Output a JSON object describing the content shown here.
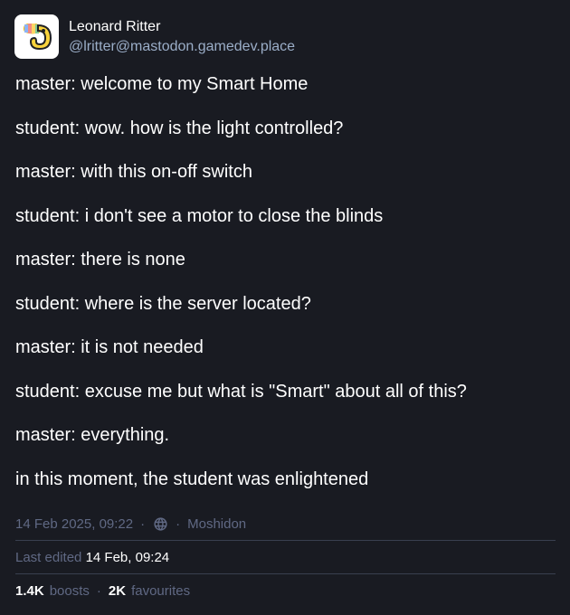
{
  "author": {
    "display_name": "Leonard Ritter",
    "handle": "@lritter@mastodon.gamedev.place",
    "avatar_icon": "toucan-avatar-icon"
  },
  "content": {
    "lines": [
      "master: welcome to my Smart Home",
      "student: wow. how is the light controlled?",
      "master: with this on-off switch",
      "student: i don't see a motor to close the blinds",
      "master: there is none",
      "student: where is the server located?",
      "master: it is not needed",
      "student: excuse me but what is \"Smart\" about all of this?",
      "master: everything.",
      "in this moment, the student was enlightened"
    ]
  },
  "meta": {
    "timestamp": "14 Feb 2025, 09:22",
    "separator": "·",
    "visibility_icon": "globe-icon",
    "application": "Moshidon"
  },
  "edited": {
    "label": "Last edited",
    "time": "14 Feb, 09:24"
  },
  "stats": {
    "boosts_count": "1.4K",
    "boosts_label": "boosts",
    "favourites_count": "2K",
    "favourites_label": "favourites",
    "separator": "·"
  },
  "colors": {
    "background": "#191b22",
    "text": "#ffffff",
    "secondary": "#606984",
    "handle": "#9baec8",
    "divider": "#393f4f"
  }
}
